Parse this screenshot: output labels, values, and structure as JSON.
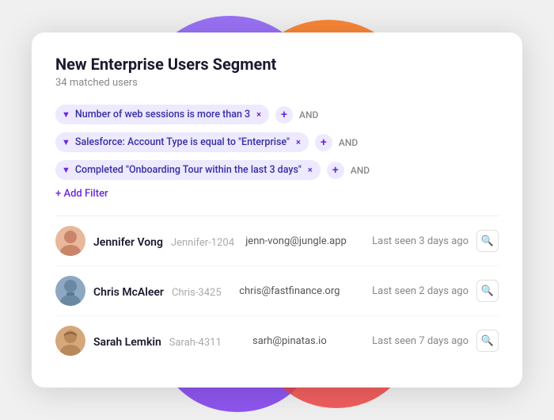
{
  "background": {
    "blobs": [
      {
        "id": "purple-top",
        "color": "#8B5CF6"
      },
      {
        "id": "orange-top",
        "color": "#F97316"
      },
      {
        "id": "purple-bottom",
        "color": "#7C3AED"
      },
      {
        "id": "orange-bottom",
        "color": "#EF4444"
      }
    ]
  },
  "card": {
    "title": "New Enterprise Users Segment",
    "subtitle": "34 matched users",
    "add_filter_label": "+ Add Filter",
    "filters": [
      {
        "id": "filter-1",
        "text": "Number of web sessions is more than 3",
        "close": "×",
        "and_label": "AND"
      },
      {
        "id": "filter-2",
        "text": "Salesforce: Account Type is equal to \"Enterprise\"",
        "close": "×",
        "and_label": "AND"
      },
      {
        "id": "filter-3",
        "text": "Completed \"Onboarding Tour within the last 3 days\"",
        "close": "×",
        "and_label": "AND"
      }
    ],
    "users": [
      {
        "id": "user-1",
        "name": "Jennifer Vong",
        "user_id": "Jennifer-1204",
        "email": "jenn-vong@jungle.app",
        "last_seen": "Last seen 3 days ago",
        "avatar_emoji": "👩"
      },
      {
        "id": "user-2",
        "name": "Chris McAleer",
        "user_id": "Chris-3425",
        "email": "chris@fastfinance.org",
        "last_seen": "Last seen 2 days ago",
        "avatar_emoji": "👨"
      },
      {
        "id": "user-3",
        "name": "Sarah Lemkin",
        "user_id": "Sarah-4311",
        "email": "sarh@pinatas.io",
        "last_seen": "Last seen 7 days ago",
        "avatar_emoji": "👩"
      }
    ]
  }
}
